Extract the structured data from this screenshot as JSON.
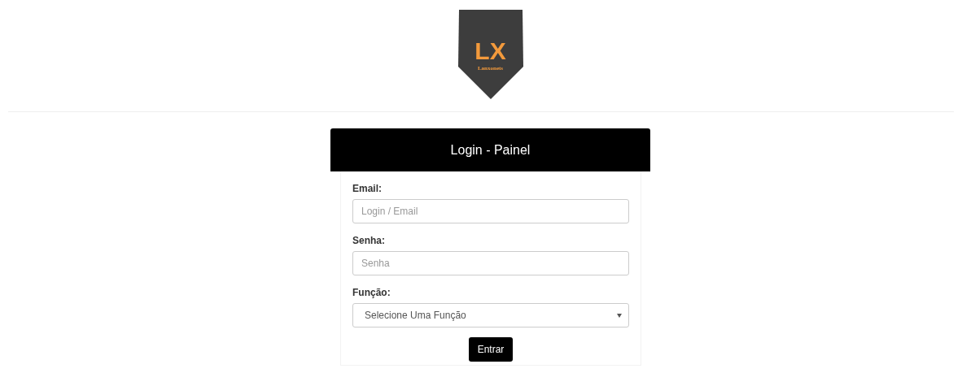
{
  "logo": {
    "monogram": "LX",
    "name": "Lanxonets"
  },
  "panel": {
    "title": "Login - Painel",
    "fields": [
      {
        "kind": "input",
        "label": "Email:",
        "placeholder": "Login / Email"
      },
      {
        "kind": "input",
        "label": "Senha:",
        "placeholder": "Senha"
      },
      {
        "kind": "select",
        "label": "Função:",
        "value": "Selecione Uma Função"
      }
    ],
    "button": "Entrar"
  }
}
